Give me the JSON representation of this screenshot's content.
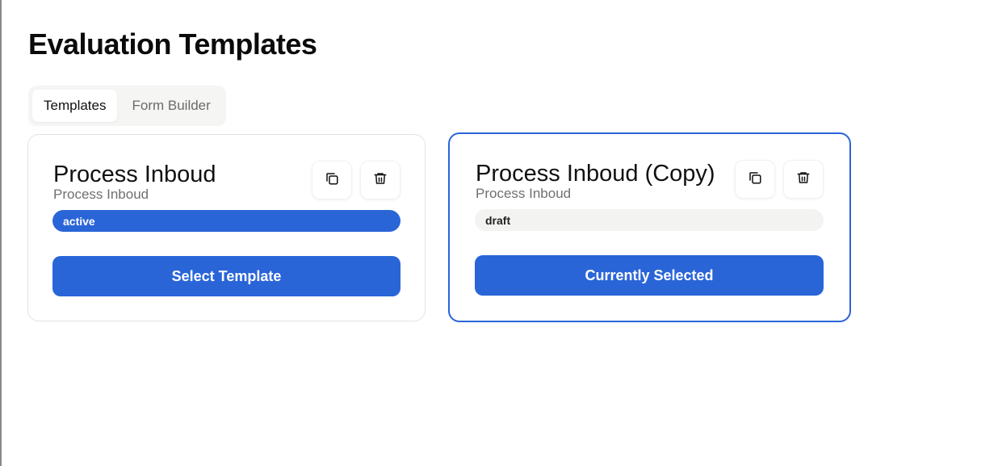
{
  "page": {
    "title": "Evaluation Templates"
  },
  "tabs": [
    {
      "label": "Templates",
      "active": true
    },
    {
      "label": "Form Builder",
      "active": false
    }
  ],
  "templates": [
    {
      "name": "Process Inboud",
      "description": "Process Inboud",
      "status": "active",
      "action_label": "Select Template",
      "selected": false,
      "copy_icon": "copy-icon",
      "delete_icon": "trash-icon"
    },
    {
      "name": "Process Inboud (Copy)",
      "description": "Process Inboud",
      "status": "draft",
      "action_label": "Currently Selected",
      "selected": true,
      "copy_icon": "copy-icon",
      "delete_icon": "trash-icon"
    }
  ],
  "colors": {
    "accent": "#2a65d8",
    "draft_badge_bg": "#f3f3f2",
    "tab_bar_bg": "#f5f5f4"
  }
}
